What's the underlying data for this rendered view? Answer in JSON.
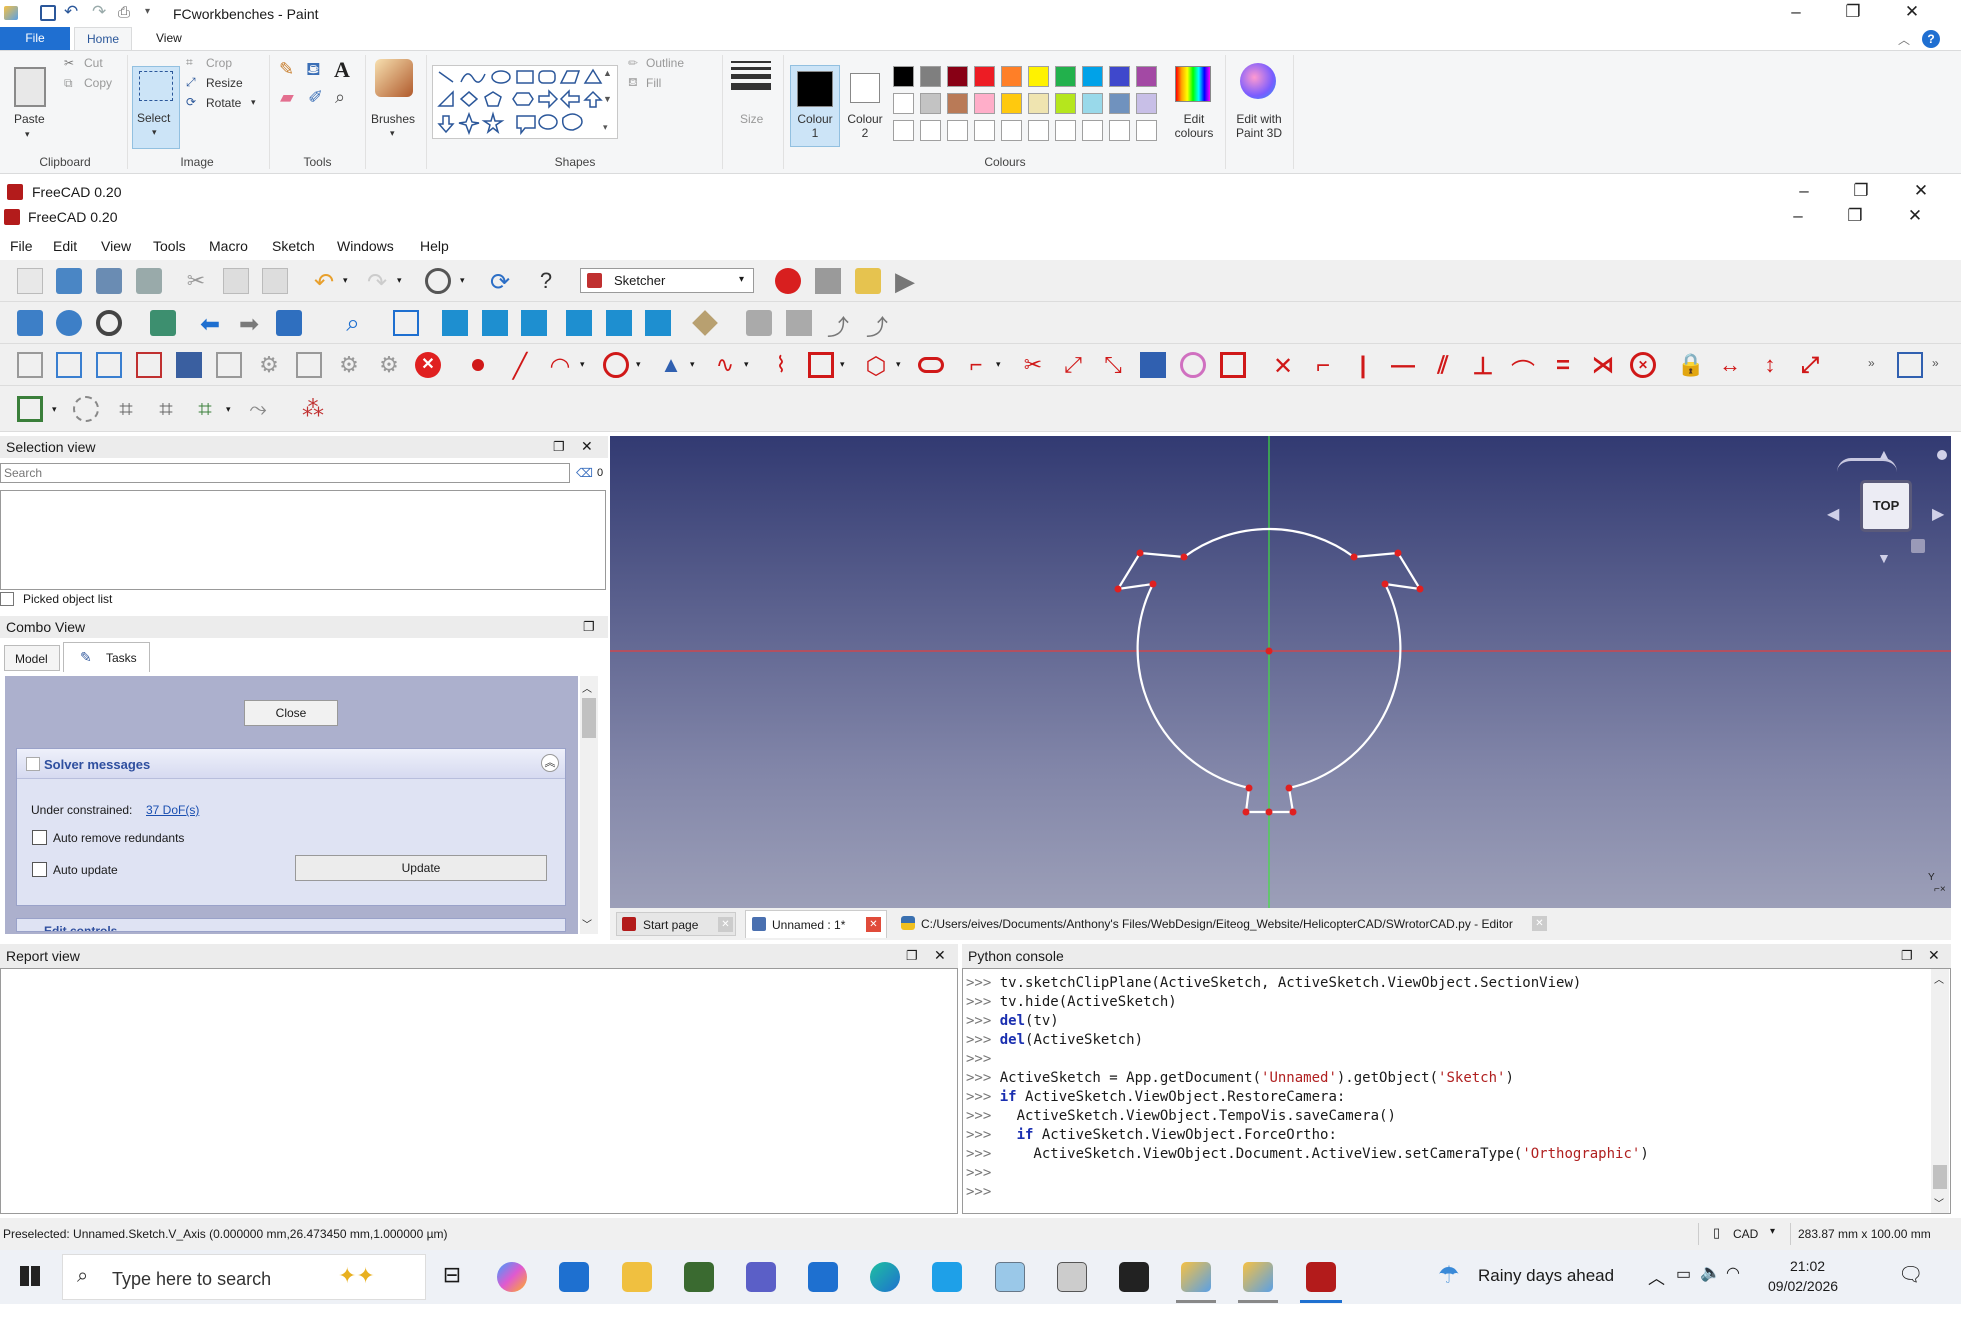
{
  "paint": {
    "title": "FCworkbenches - Paint",
    "tabs": [
      "File",
      "Home",
      "View"
    ],
    "clipboard": {
      "paste": "Paste",
      "cut": "Cut",
      "copy": "Copy",
      "group": "Clipboard"
    },
    "image": {
      "select": "Select",
      "crop": "Crop",
      "resize": "Resize",
      "rotate": "Rotate",
      "group": "Image"
    },
    "tools_group": "Tools",
    "brushes": "Brushes",
    "shapes": {
      "outline": "Outline",
      "fill": "Fill",
      "group": "Shapes"
    },
    "size": "Size",
    "colour1": "Colour 1",
    "colour2": "Colour 2",
    "edit_colours": "Edit colours",
    "edit_paint3d": "Edit with Paint 3D",
    "colours_group": "Colours",
    "palette_row1": [
      "#000000",
      "#7f7f7f",
      "#880015",
      "#ed1c24",
      "#ff7f27",
      "#fff200",
      "#22b14c",
      "#00a2e8",
      "#3f48cc",
      "#a349a4"
    ],
    "palette_row2": [
      "#ffffff",
      "#c3c3c3",
      "#b97a57",
      "#ffaec9",
      "#ffc90e",
      "#efe4b0",
      "#b5e61d",
      "#99d9ea",
      "#7092be",
      "#c8bfe7"
    ]
  },
  "freecad": {
    "title1": "FreeCAD 0.20",
    "title2": "FreeCAD 0.20",
    "menu": [
      "File",
      "Edit",
      "View",
      "Tools",
      "Macro",
      "Sketch",
      "Windows",
      "Help"
    ],
    "workbench": "Sketcher",
    "selection_view": {
      "title": "Selection view",
      "search_placeholder": "Search",
      "count": "0",
      "picked": "Picked object list"
    },
    "combo_view": {
      "title": "Combo View",
      "tab_model": "Model",
      "tab_tasks": "Tasks",
      "close": "Close",
      "solver_title": "Solver messages",
      "under_constrained": "Under constrained:",
      "dof": "37 DoF(s)",
      "auto_remove": "Auto remove redundants",
      "auto_update": "Auto update",
      "update": "Update",
      "edit_controls": "Edit controls"
    },
    "nav_cube": "TOP",
    "axis_label": "Y",
    "doc_tabs": [
      "Start page",
      "Unnamed : 1*",
      "C:/Users/eives/Documents/Anthony's Files/WebDesign/Eiteog_Website/HelicopterCAD/SWrotorCAD.py - Editor"
    ],
    "report_view": "Report view",
    "python_console": "Python console",
    "console_lines": [
      ">>> tv.sketchClipPlane(ActiveSketch, ActiveSketch.ViewObject.SectionView)",
      ">>> tv.hide(ActiveSketch)",
      ">>> del(tv)",
      ">>> del(ActiveSketch)",
      ">>> ",
      ">>> ActiveSketch = App.getDocument('Unnamed').getObject('Sketch')",
      ">>> if ActiveSketch.ViewObject.RestoreCamera:",
      ">>>   ActiveSketch.ViewObject.TempoVis.saveCamera()",
      ">>>   if ActiveSketch.ViewObject.ForceOrtho:",
      ">>>     ActiveSketch.ViewObject.Document.ActiveView.setCameraType('Orthographic')",
      ">>> ",
      ">>> "
    ],
    "status": "Preselected: Unnamed.Sketch.V_Axis (0.000000 mm,26.473450 mm,1.000000 µm)",
    "nav_style": "CAD",
    "dimensions": "283.87 mm x 100.00 mm"
  },
  "taskbar": {
    "search_placeholder": "Type here to search",
    "weather": "Rainy days ahead",
    "time": "21:02",
    "date": "09/02/2026"
  }
}
